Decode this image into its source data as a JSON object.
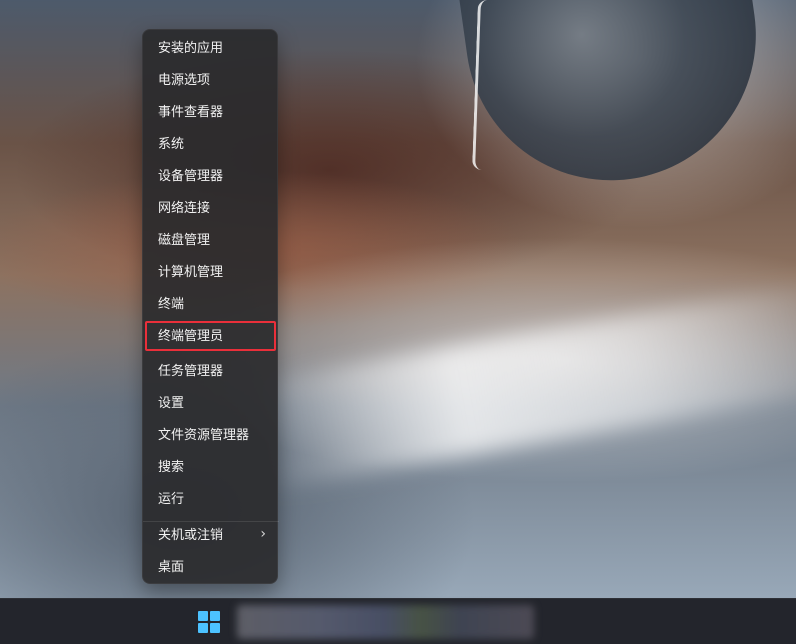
{
  "menu": {
    "items": [
      {
        "label": "安装的应用",
        "has_submenu": false
      },
      {
        "label": "电源选项",
        "has_submenu": false
      },
      {
        "label": "事件查看器",
        "has_submenu": false
      },
      {
        "label": "系统",
        "has_submenu": false
      },
      {
        "label": "设备管理器",
        "has_submenu": false
      },
      {
        "label": "网络连接",
        "has_submenu": false
      },
      {
        "label": "磁盘管理",
        "has_submenu": false
      },
      {
        "label": "计算机管理",
        "has_submenu": false
      },
      {
        "label": "终端",
        "has_submenu": false
      },
      {
        "label": "终端管理员",
        "has_submenu": false,
        "highlighted": true
      },
      {
        "label": "任务管理器",
        "has_submenu": false
      },
      {
        "label": "设置",
        "has_submenu": false
      },
      {
        "label": "文件资源管理器",
        "has_submenu": false
      },
      {
        "label": "搜索",
        "has_submenu": false
      },
      {
        "label": "运行",
        "has_submenu": false
      },
      {
        "label": "关机或注销",
        "has_submenu": true,
        "submenu_icon": "chevron-right-icon"
      },
      {
        "label": "桌面",
        "has_submenu": false
      }
    ]
  },
  "taskbar": {
    "start_icon": "windows-start-icon"
  },
  "colors": {
    "menu_background": "#2a2a2d",
    "menu_text": "#f2f2f2",
    "highlight_border": "#ea2f3a",
    "start_icon": "#4cc2ff"
  }
}
